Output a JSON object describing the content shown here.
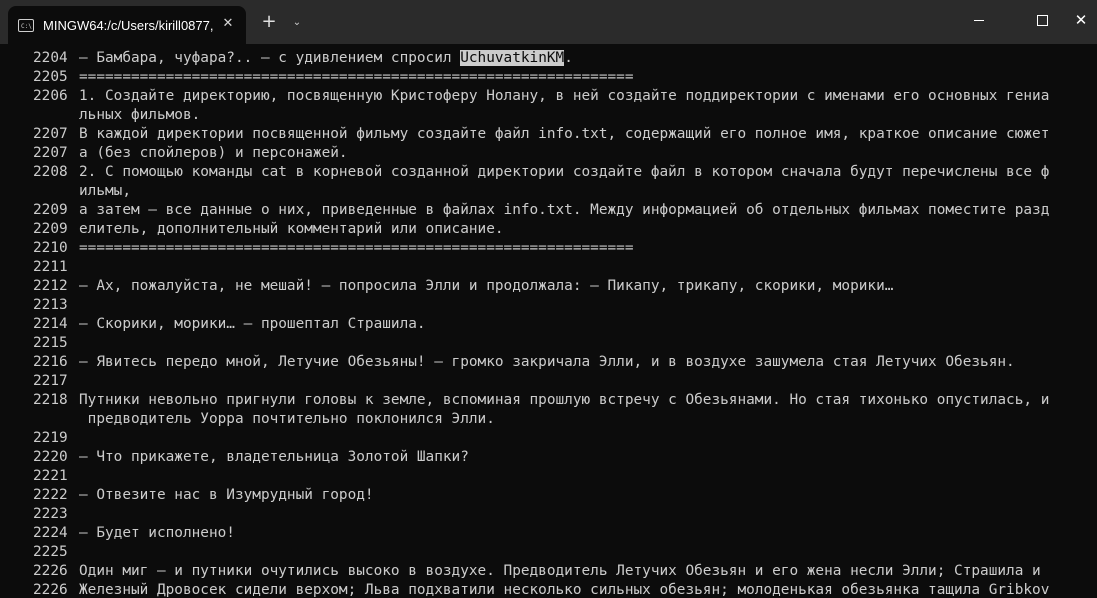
{
  "window": {
    "tab_title": "MINGW64:/c/Users/kirill0877,",
    "tab_icon_glyph": "C:\\",
    "close_tab_glyph": "✕",
    "new_tab_glyph": "+",
    "dropdown_glyph": "⌄",
    "close_window_glyph": "✕"
  },
  "terminal": {
    "lines": [
      {
        "num": "2204",
        "pre": "– Бамбара, чуфара?.. – с удивлением спросил ",
        "hl": "UchuvatkinKM",
        "post": "."
      },
      {
        "num": "2205",
        "text": "================================================================"
      },
      {
        "num": "2206",
        "text": "1. Создайте директорию, посвященную Кристоферу Нолану, в ней создайте поддиректории с именами его основных гениа"
      },
      {
        "num": "",
        "text": "льных фильмов."
      },
      {
        "num": "2207",
        "text": "В каждой директории посвященной фильму создайте файл info.txt, содержащий его полное имя, краткое описание сюжет"
      },
      {
        "num": "2207",
        "text": "а (без спойлеров) и персонажей."
      },
      {
        "num": "2208",
        "text": "2. С помощью команды cat в корневой созданной директории создайте файл в котором сначала будут перечислены все ф"
      },
      {
        "num": "",
        "text": "ильмы,"
      },
      {
        "num": "2209",
        "text": "а затем – все данные о них, приведенные в файлах info.txt. Между информацией об отдельных фильмах поместите разд"
      },
      {
        "num": "2209",
        "text": "елитель, дополнительный комментарий или описание."
      },
      {
        "num": "2210",
        "text": "================================================================"
      },
      {
        "num": "2211",
        "text": ""
      },
      {
        "num": "2212",
        "text": "– Ах, пожалуйста, не мешай! – попросила Элли и продолжала: – Пикапу, трикапу, скорики, морики…"
      },
      {
        "num": "2213",
        "text": ""
      },
      {
        "num": "2214",
        "text": "– Скорики, морики… – прошептал Страшила."
      },
      {
        "num": "2215",
        "text": ""
      },
      {
        "num": "2216",
        "text": "– Явитесь передо мной, Летучие Обезьяны! – громко закричала Элли, и в воздухе зашумела стая Летучих Обезьян."
      },
      {
        "num": "2217",
        "text": ""
      },
      {
        "num": "2218",
        "text": "Путники невольно пригнули головы к земле, вспоминая прошлую встречу с Обезьянами. Но стая тихонько опустилась, и"
      },
      {
        "num": "",
        "text": " предводитель Уорра почтительно поклонился Элли."
      },
      {
        "num": "2219",
        "text": ""
      },
      {
        "num": "2220",
        "text": "– Что прикажете, владетельница Золотой Шапки?"
      },
      {
        "num": "2221",
        "text": ""
      },
      {
        "num": "2222",
        "text": "– Отвезите нас в Изумрудный город!"
      },
      {
        "num": "2223",
        "text": ""
      },
      {
        "num": "2224",
        "text": "– Будет исполнено!"
      },
      {
        "num": "2225",
        "text": ""
      },
      {
        "num": "2226",
        "text": "Один миг – и путники очутились высоко в воздухе. Предводитель Летучих Обезьян и его жена несли Элли; Страшила и"
      },
      {
        "num": "2226",
        "text": "Железный Дровосек сидели верхом; Льва подхватили несколько сильных обезьян; молоденькая обезьянка тащила Gribkov"
      }
    ]
  }
}
